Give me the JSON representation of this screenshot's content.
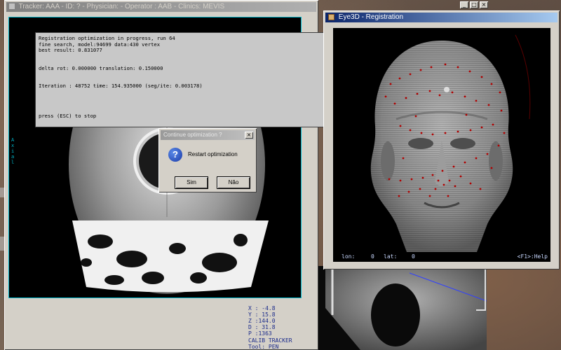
{
  "tracker": {
    "title": "Tracker: AAA - ID:  ? - Physician:  - Operator : AAB - Clinics: MEVIS",
    "side_label": "Axial",
    "coords": {
      "x": "X : -4.8",
      "y": "Y : 15.8",
      "z": "Z :144.0",
      "d": "D : 31.8",
      "p": "P :1363"
    },
    "calib": "CALIB TRACKER",
    "tool": "Tool: PEN"
  },
  "log": {
    "line1": "Registration optimization in progress, run 64",
    "line2": "fine search, model:94699  data:430 vertex",
    "line3": "best result: 0.831077",
    "line4": "delta rot: 0.000000  translation: 0.150000",
    "line5": "Iteration  : 48752  time: 154.935000 (seg/ite: 0.003178)",
    "line6": "press (ESC) to stop"
  },
  "dialog": {
    "title": "Continue optimization ?",
    "message": "Restart optimization",
    "yes": "Sim",
    "no": "Não"
  },
  "eye3d": {
    "title": "Eye3D - Registration",
    "lon_label": "lon:",
    "lon_value": "0",
    "lat_label": "lat:",
    "lat_value": "0",
    "help": "<F1>:Help"
  },
  "icons": {
    "question": "question-icon",
    "app": "eye3d-app-icon"
  },
  "colors": {
    "point_red": "#b00000",
    "hud_text": "#c8d8ff",
    "cyan_border": "#00b4c8"
  }
}
